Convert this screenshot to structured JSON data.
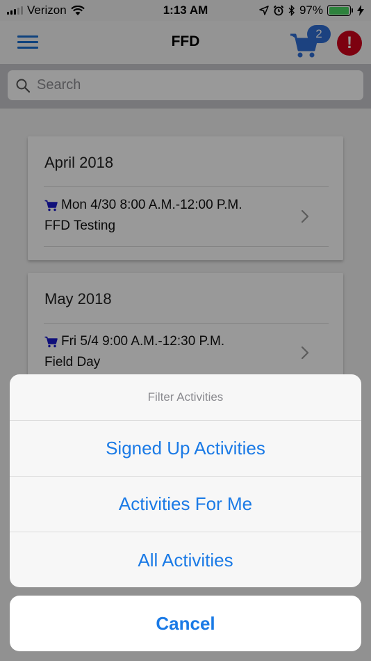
{
  "status_bar": {
    "carrier": "Verizon",
    "time": "1:13 AM",
    "battery_percent_label": "97%",
    "battery_level": 0.97
  },
  "nav": {
    "title": "FFD",
    "cart_count": "2",
    "alert_symbol": "!"
  },
  "search": {
    "placeholder": "Search"
  },
  "months": [
    {
      "title": "April 2018",
      "events": [
        {
          "datetime": "Mon 4/30 8:00 A.M.-12:00 P.M.",
          "name": "FFD Testing"
        }
      ]
    },
    {
      "title": "May 2018",
      "events": [
        {
          "datetime": "Fri 5/4 9:00 A.M.-12:30 P.M.",
          "name": "Field Day"
        }
      ]
    }
  ],
  "action_sheet": {
    "title": "Filter Activities",
    "options": [
      {
        "label": "Signed Up Activities"
      },
      {
        "label": "Activities For Me"
      },
      {
        "label": "All Activities"
      }
    ],
    "cancel_label": "Cancel"
  },
  "colors": {
    "accent": "#1a7ae6",
    "cart_badge": "#2f6fd6",
    "alert": "#d0021b",
    "battery": "#4cd964",
    "cart_icon_small": "#1a1acc"
  },
  "icons": {
    "menu": "hamburger-icon",
    "cart": "cart-icon",
    "alert": "alert-icon",
    "search": "search-icon",
    "event_cart": "cart-icon",
    "chevron": "chevron-right-icon"
  }
}
